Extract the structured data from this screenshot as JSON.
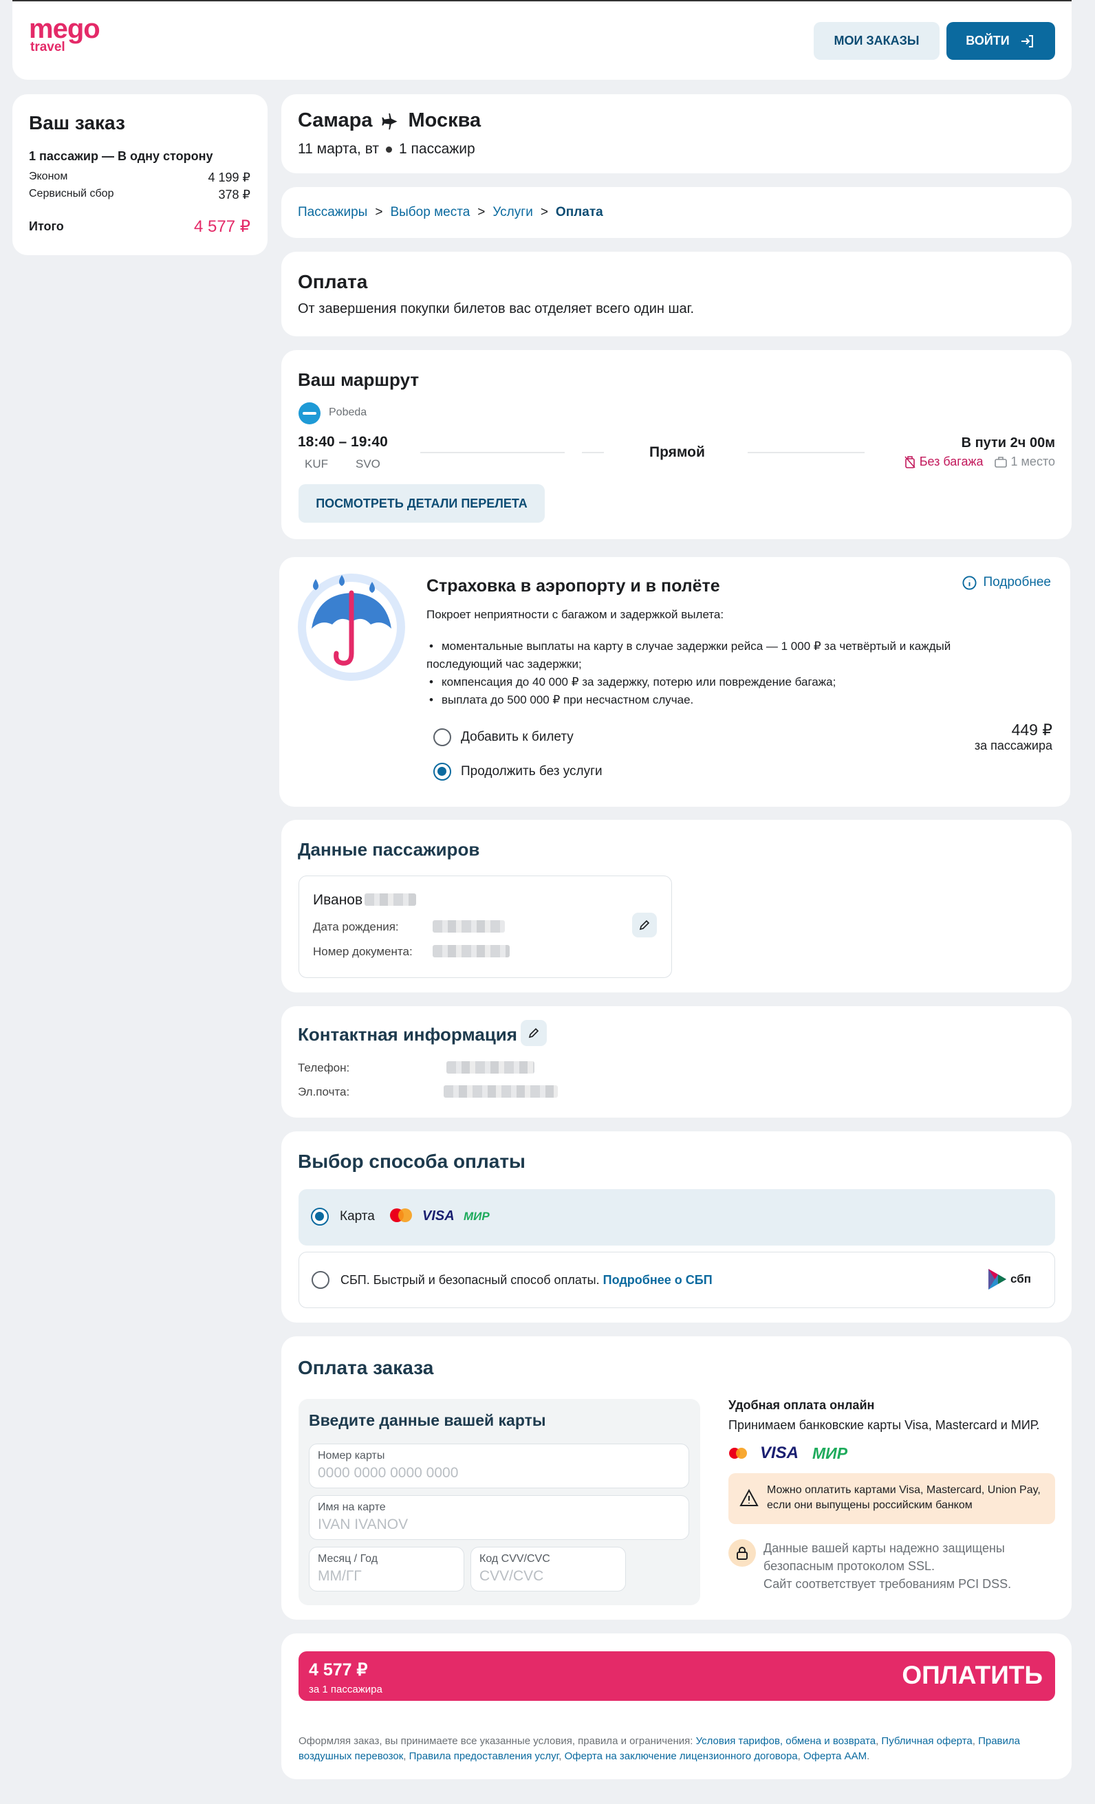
{
  "header": {
    "logo_top": "mego",
    "logo_bottom": "travel",
    "my_orders": "МОИ ЗАКАЗЫ",
    "login": "ВОЙТИ"
  },
  "order": {
    "title": "Ваш заказ",
    "subtitle": "1 пассажир — В одну сторону",
    "lines": [
      {
        "label": "Эконом",
        "value": "4 199 ₽"
      },
      {
        "label": "Сервисный сбор",
        "value": "378 ₽"
      }
    ],
    "total_label": "Итого",
    "total_value": "4 577 ₽"
  },
  "route_header": {
    "from": "Самара",
    "to": "Москва",
    "date": "11 марта, вт",
    "passengers": "1 пассажир"
  },
  "breadcrumbs": [
    "Пассажиры",
    "Выбор места",
    "Услуги",
    "Оплата"
  ],
  "payment_intro": {
    "title": "Оплата",
    "text": "От завершения покупки билетов вас отделяет всего один шаг."
  },
  "route": {
    "title": "Ваш маршрут",
    "airline": "Pobeda",
    "times": "18:40 – 19:40",
    "from_code": "KUF",
    "to_code": "SVO",
    "type": "Прямой",
    "duration": "В пути 2ч 00м",
    "baggage": "Без багажа",
    "handbag": "1 место",
    "details_button": "ПОСМОТРЕТЬ ДЕТАЛИ ПЕРЕЛЕТА"
  },
  "insurance": {
    "title": "Страховка в аэропорту и в полёте",
    "more": "Подробнее",
    "intro": "Покроет неприятности с багажом и задержкой вылета:",
    "items": [
      "моментальные выплаты на карту в случае задержки рейса — 1 000 ₽ за четвёртый и каждый последующий час задержки;",
      "компенсация до 40 000 ₽ за задержку, потерю или повреждение багажа;",
      "выплата до 500 000 ₽ при несчастном случае."
    ],
    "option_add": "Добавить к билету",
    "option_skip": "Продолжить без услуги",
    "price": "449 ₽",
    "price_note": "за пассажира"
  },
  "passengers": {
    "title": "Данные пассажиров",
    "name": "Иванов",
    "birth_label": "Дата рождения:",
    "doc_label": "Номер документа:"
  },
  "contact": {
    "title": "Контактная информация",
    "phone_label": "Телефон:",
    "email_label": "Эл.почта:"
  },
  "payment_method": {
    "title": "Выбор способа оплаты",
    "card_label": "Карта",
    "visa": "VISA",
    "mir": "МИР",
    "sbp_text": "СБП. Быстрый и безопасный способ оплаты.",
    "sbp_link": "Подробнее о СБП",
    "sbp_logo": "сбп"
  },
  "card_form": {
    "section_title": "Оплата заказа",
    "box_title": "Введите данные вашей карты",
    "number_label": "Номер карты",
    "number_placeholder": "0000 0000 0000 0000",
    "name_label": "Имя на карте",
    "name_placeholder": "IVAN IVANOV",
    "exp_label": "Месяц / Год",
    "exp_placeholder": "ММ/ГГ",
    "cvv_label": "Код CVV/CVC",
    "cvv_placeholder": "CVV/CVC"
  },
  "online_info": {
    "title": "Удобная оплата онлайн",
    "text": "Принимаем банковские карты Visa, Mastercard и МИР.",
    "visa": "VISA",
    "mir": "МИР",
    "warning": "Можно оплатить картами Visa, Mastercard, Union Pay, если они выпущены российским банком",
    "secure_1": "Данные вашей карты надежно защищены",
    "secure_2": "безопасным протоколом SSL.",
    "secure_3": "Сайт соответствует требованиям PCI DSS."
  },
  "pay_bar": {
    "amount": "4 577 ₽",
    "note": "за 1 пассажира",
    "button": "ОПЛАТИТЬ"
  },
  "terms": {
    "prefix": "Оформляя заказ, вы принимаете все указанные условия, правила и ограничения:",
    "links": [
      "Условия тарифов, обмена и возврата",
      "Публичная оферта",
      "Правила воздушных перевозок",
      "Правила предоставления услуг",
      "Оферта на заключение лицензионного договора",
      "Оферта ААМ"
    ]
  },
  "colors": {
    "accent_blue": "#0b6a9f",
    "brand_pink": "#e42a68",
    "bg": "#eef0f3"
  }
}
